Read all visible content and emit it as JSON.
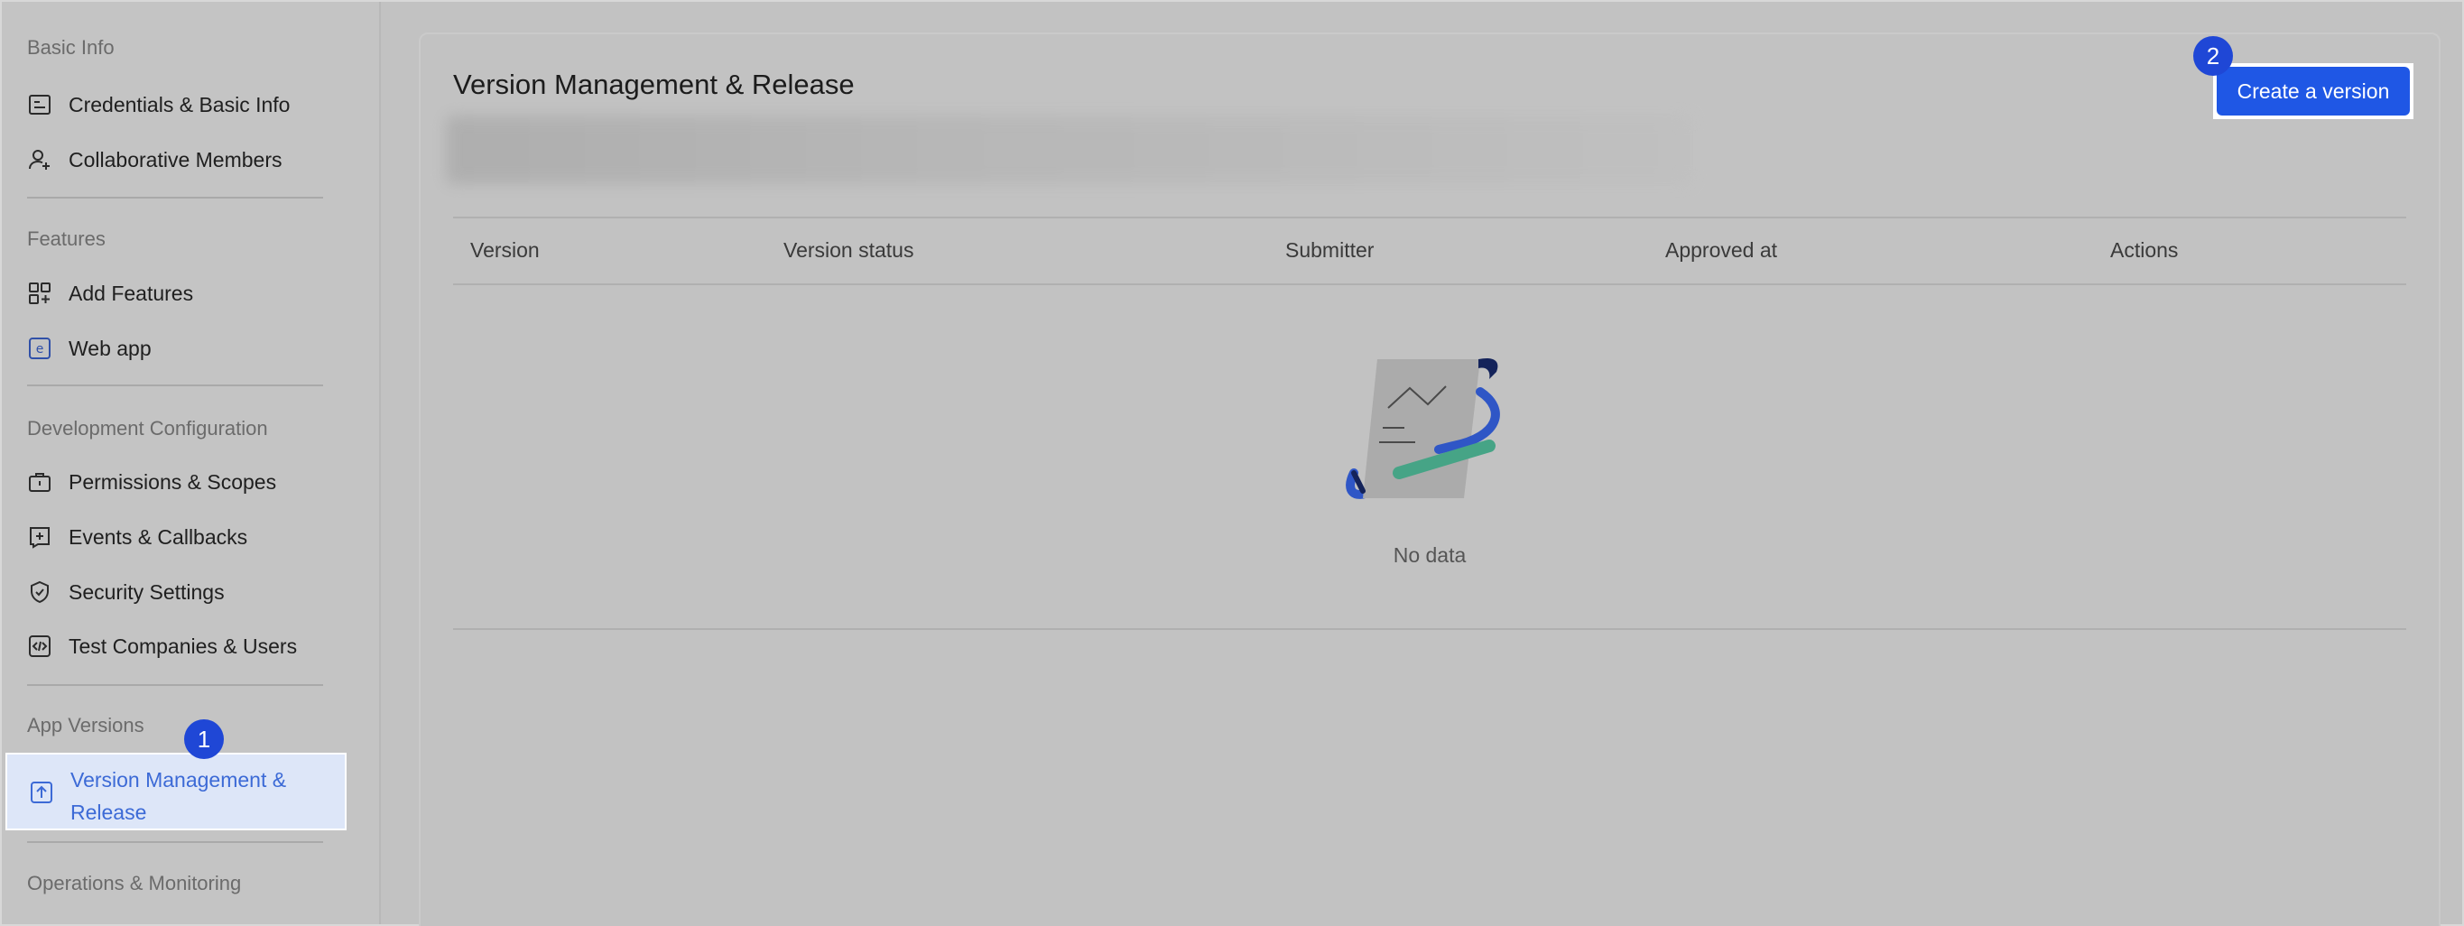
{
  "sidebar": {
    "groups": {
      "basic_info": "Basic Info",
      "features": "Features",
      "dev_config": "Development Configuration",
      "app_versions": "App Versions",
      "ops": "Operations & Monitoring"
    },
    "items": {
      "credentials": "Credentials & Basic Info",
      "members": "Collaborative Members",
      "add_features": "Add Features",
      "web_app": "Web app",
      "permissions": "Permissions & Scopes",
      "events": "Events & Callbacks",
      "security": "Security Settings",
      "test": "Test Companies & Users",
      "version_mgmt": "Version Management & Release"
    }
  },
  "badges": {
    "first": "1",
    "second": "2"
  },
  "main": {
    "title": "Version Management & Release",
    "create_button": "Create a version",
    "table": {
      "columns": [
        "Version",
        "Version status",
        "Submitter",
        "Approved at",
        "Actions"
      ],
      "empty_text": "No data"
    }
  },
  "colors": {
    "accent": "#1f57e5",
    "badge": "#1f47d6",
    "active_bg": "#dde6f8",
    "active_text": "#3c6ad6"
  }
}
